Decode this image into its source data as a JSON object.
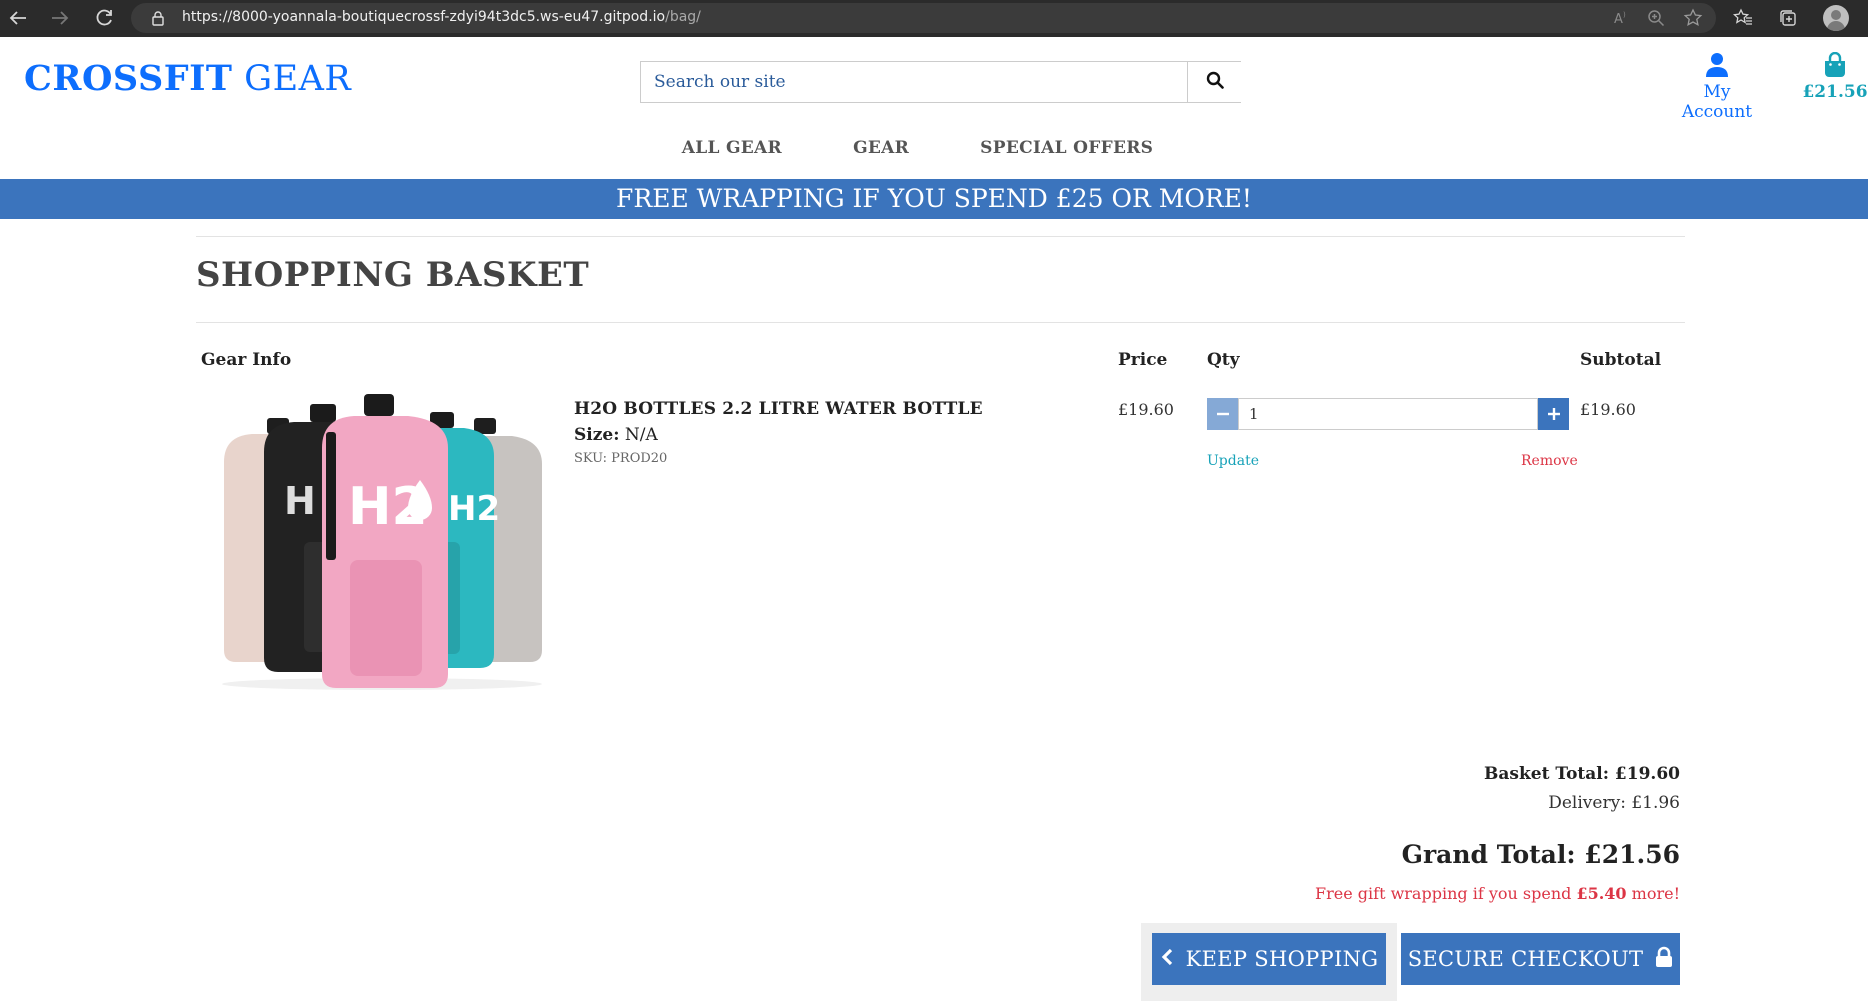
{
  "browser": {
    "url_main": "https://8000-yoannala-boutiquecrossf-zdyi94t3dc5.ws-eu47.gitpod.io",
    "url_path": "/bag/"
  },
  "header": {
    "logo_strong": "CROSSFIT",
    "logo_light": " GEAR",
    "search_placeholder": "Search our site",
    "account_label": "My Account",
    "bag_total": "£21.56"
  },
  "nav": {
    "items": [
      "ALL GEAR",
      "GEAR",
      "SPECIAL OFFERS"
    ]
  },
  "banner": {
    "text": "FREE WRAPPING IF YOU SPEND £25 OR MORE!"
  },
  "basket": {
    "title": "SHOPPING BASKET",
    "columns": {
      "info": "Gear Info",
      "price": "Price",
      "qty": "Qty",
      "subtotal": "Subtotal"
    },
    "items": [
      {
        "name": "H2O BOTTLES 2.2 LITRE WATER BOTTLE",
        "size_label": "Size:",
        "size_value": " N/A",
        "sku": "SKU: PROD20",
        "price": "£19.60",
        "quantity": "1",
        "subtotal": "£19.60",
        "update_label": "Update",
        "remove_label": "Remove"
      }
    ]
  },
  "totals": {
    "basket_total": "Basket Total: £19.60",
    "delivery": "Delivery: £1.96",
    "grand_total": "Grand Total: £21.56",
    "gift_prefix": "Free gift wrapping if you spend ",
    "gift_amount": "£5.40",
    "gift_suffix": " more!"
  },
  "buttons": {
    "keep_shopping": "KEEP SHOPPING",
    "secure_checkout": "SECURE CHECKOUT"
  },
  "colors": {
    "brand_blue": "#0d6efd",
    "banner_blue": "#3b74bd",
    "teal": "#17a2b8",
    "danger": "#dc3545"
  },
  "icons": [
    "back-icon",
    "forward-icon",
    "reload-icon",
    "lock-icon",
    "read-aloud-icon",
    "zoom-icon",
    "add-favorite-icon",
    "favorites-icon",
    "collections-icon",
    "profile-icon",
    "search-icon",
    "user-icon",
    "shopping-bag-icon",
    "minus-icon",
    "plus-icon",
    "chevron-left-icon",
    "padlock-icon"
  ]
}
